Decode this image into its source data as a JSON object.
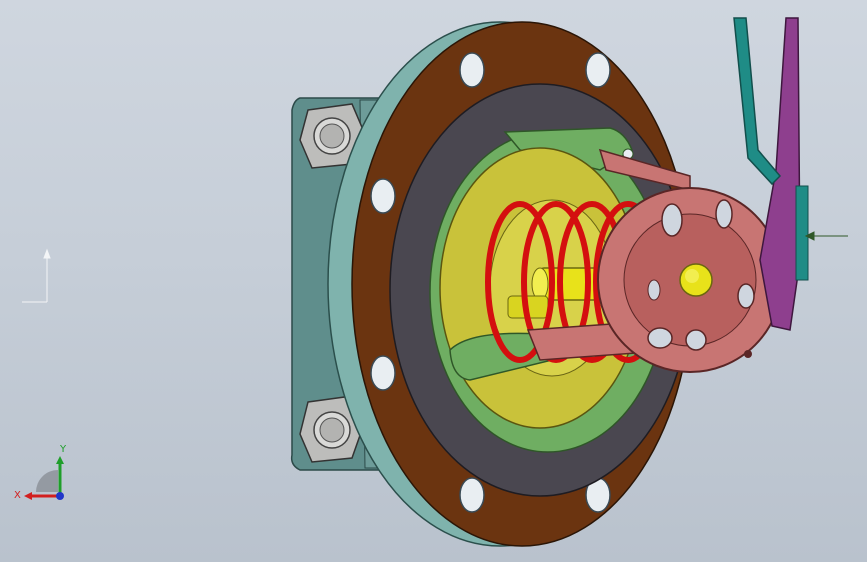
{
  "viewport": {
    "background_top": "#cfd6df",
    "background_bottom": "#b9c2cd",
    "model": "valve-with-handwheel-and-lever",
    "colors": {
      "flange": "#6b3410",
      "flange_rim": "#7fb3ad",
      "gasket": "#4a4750",
      "body": "#6fae62",
      "disc": "#c9c23a",
      "spring": "#d40f0f",
      "shaft": "#e8e21a",
      "handwheel": "#c87573",
      "lever_purple": "#8e3f8e",
      "lever_teal": "#1f8c86",
      "bolt": "#c8c8c6",
      "bracket": "#5f8e8c"
    }
  },
  "triad": {
    "x_label": "X",
    "y_label": "Y",
    "x_color": "#d21f1f",
    "y_color": "#1f9e2a",
    "z_color": "#2136c9"
  }
}
